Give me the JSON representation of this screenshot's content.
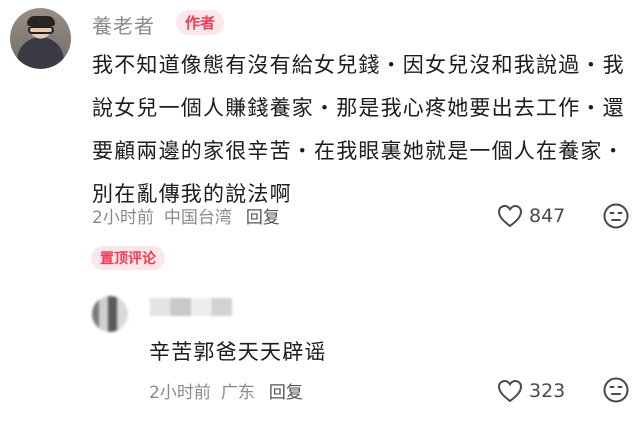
{
  "comment": {
    "username": "養老者",
    "author_badge": "作者",
    "text": "我不知道像態有沒有給女兒錢・因女兒沒和我說過・我說女兒一個人賺錢養家・那是我心疼她要出去工作・還要顧兩邊的家很辛苦・在我眼裏她就是一個人在養家・別在亂傳我的說法啊",
    "time": "2小时前",
    "location": "中国台湾",
    "reply_label": "回复",
    "likes": "847"
  },
  "pinned_badge": "置顶评论",
  "reply": {
    "text": "辛苦郭爸天天辟谣",
    "time": "2小时前",
    "location": "广东",
    "reply_label": "回复",
    "likes": "323"
  },
  "icons": {
    "like": "heart-outline-icon",
    "emoji": "neutral-face-icon"
  },
  "colors": {
    "badge_text": "#ee3b56",
    "badge_bg": "#fde7ea",
    "meta_gray": "#8a8a8a"
  }
}
